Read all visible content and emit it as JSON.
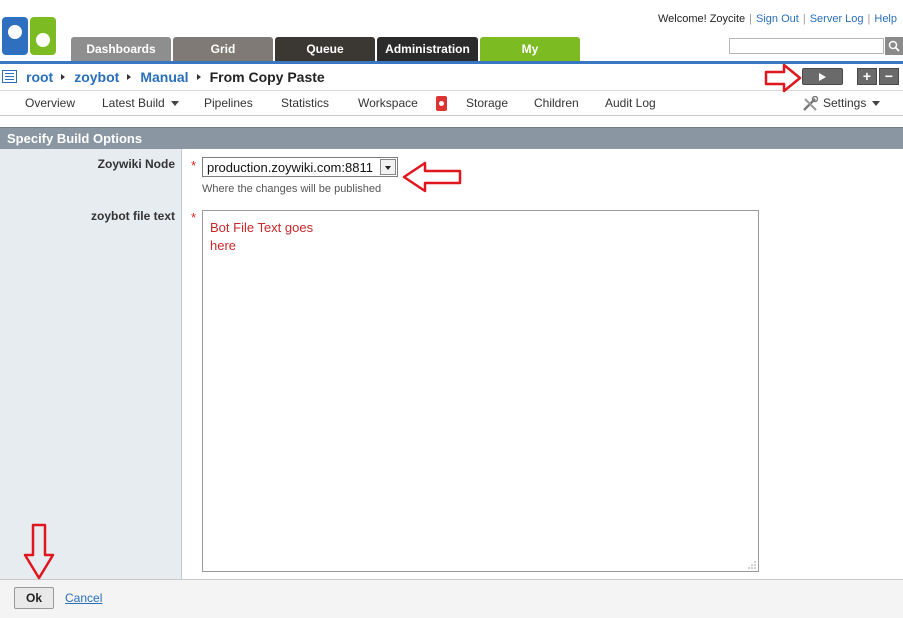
{
  "header": {
    "welcome": "Welcome! Zoycite",
    "links": [
      "Sign Out",
      "Server Log",
      "Help"
    ],
    "tabs": [
      "Dashboards",
      "Grid",
      "Queue",
      "Administration",
      "My"
    ]
  },
  "breadcrumb": {
    "items": [
      "root",
      "zoybot",
      "Manual"
    ],
    "current": "From Copy Paste"
  },
  "subnav": {
    "items": [
      "Overview",
      "Latest Build",
      "Pipelines",
      "Statistics",
      "Workspace",
      "Storage",
      "Children",
      "Audit Log"
    ],
    "settings": "Settings"
  },
  "panel": {
    "title": "Specify Build Options"
  },
  "form": {
    "node_label": "Zoywiki Node",
    "node_value": "production.zoywiki.com:8811",
    "node_hint": "Where the changes will be published",
    "text_label": "zoybot file text",
    "text_value": "Bot File Text goes\nhere"
  },
  "footer": {
    "ok": "Ok",
    "cancel": "Cancel"
  },
  "colors": {
    "accent_blue": "#3a77c2",
    "annotation_red": "#e0161e",
    "tab_my_green": "#7cbb22"
  }
}
